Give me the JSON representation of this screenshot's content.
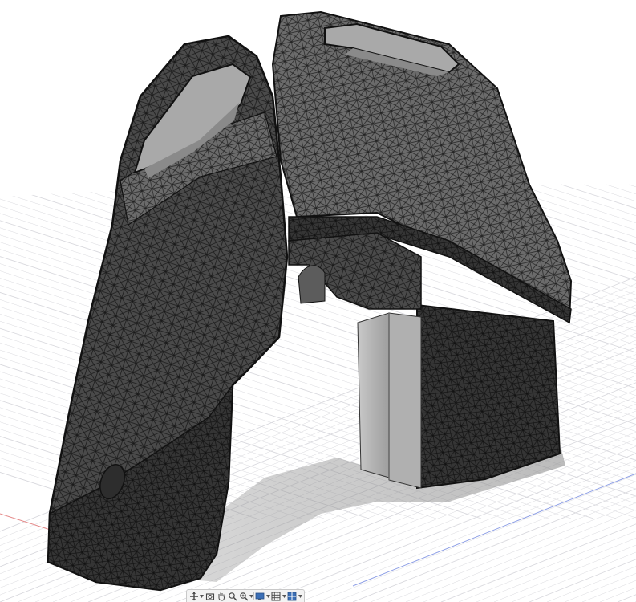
{
  "viewport": {
    "background": "#ffffff",
    "grid_color": "#d9d9de",
    "axis_x_color": "#e58a8a",
    "axis_y_color": "#8fa0e6",
    "model": {
      "mesh_dark": "#3a3a3a",
      "mesh_mid": "#555555",
      "mesh_light": "#7a7a7a",
      "cavity": "#b9b9b9",
      "post": "#c7c7c7",
      "outline": "#111111"
    }
  },
  "toolbar": {
    "icons": [
      "orbit-icon",
      "look-at-icon",
      "pan-icon",
      "zoom-icon",
      "fit-icon",
      "display-mode-icon",
      "grid-icon",
      "viewports-icon"
    ]
  }
}
